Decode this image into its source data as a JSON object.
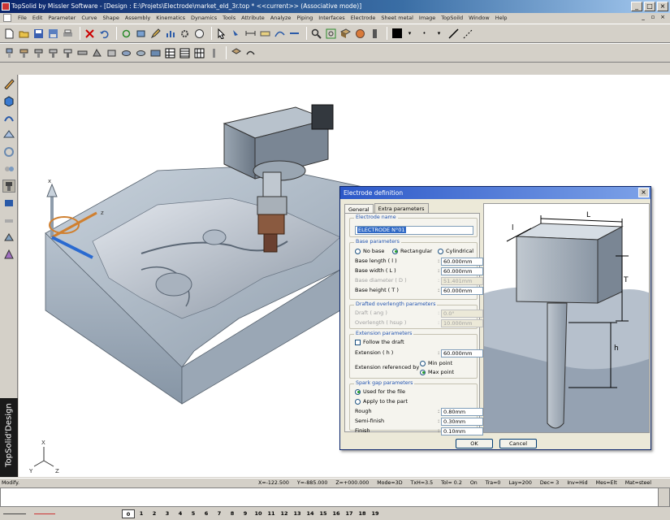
{
  "window": {
    "title": "TopSolid by Missler Software - [Design : E:\\Projets\\Electrode\\market_eld_3r.top *  <<current>> (Associative mode)]"
  },
  "menu": [
    "File",
    "Edit",
    "Parameter",
    "Curve",
    "Shape",
    "Assembly",
    "Kinematics",
    "Dynamics",
    "Tools",
    "Attribute",
    "Analyze",
    "Piping",
    "Interfaces",
    "Electrode",
    "Sheet metal",
    "Image",
    "TopSoild",
    "Window",
    "Help"
  ],
  "brand": {
    "text": "TopSolid'Design"
  },
  "dialog": {
    "title": "Electrode definition",
    "tabs": [
      "General",
      "Extra parameters"
    ],
    "electrode_name": {
      "title": "Electrode name",
      "value": "ELECTRODE N°01"
    },
    "base": {
      "title": "Base parameters",
      "options": [
        "No base",
        "Rectangular",
        "Cylindrical"
      ],
      "selected": "Rectangular",
      "length_label": "Base length ( l )",
      "length": "60.000mm",
      "width_label": "Base width ( L )",
      "width": "60.000mm",
      "diameter_label": "Base diameter ( D )",
      "diameter": "51.401mm",
      "height_label": "Base height ( T )",
      "height": "60.000mm"
    },
    "draft": {
      "title": "Drafted overlength parameters",
      "draft_label": "Draft ( ang )",
      "draft": "0.0°",
      "overlength_label": "Overlength ( hsup )",
      "overlength": "10.000mm"
    },
    "extension": {
      "title": "Extension parameters",
      "follow_label": "Follow the draft",
      "ext_label": "Extension ( h )",
      "ext": "60.000mm",
      "ref_label": "Extension referenced by",
      "ref_options": [
        "Min point",
        "Max point"
      ],
      "ref_selected": "Max point"
    },
    "spark": {
      "title": "Spark gap parameters",
      "options": [
        "Used for the file",
        "Apply to the part"
      ],
      "selected": "Used for the file",
      "rough_label": "Rough",
      "rough": "0.80mm",
      "semi_label": "Semi-finish",
      "semi": "0.30mm",
      "finish_label": "Finish",
      "finish": "0.10mm"
    },
    "ok": "OK",
    "cancel": "Cancel",
    "preview_labels": {
      "L": "L",
      "l": "l",
      "T": "T",
      "h": "h"
    }
  },
  "axes": {
    "x": "X",
    "y": "Y",
    "z": "Z",
    "gx": "x",
    "gz": "z"
  },
  "status": {
    "left": "Modify.",
    "fields": [
      "X=-122.500",
      "Y=-885.000",
      "Z=+000.000",
      "Mode=3D",
      "TxH=3.5",
      "Tol=  0.2",
      "On",
      "Tra=0",
      "Lay=200",
      "Dec= 3",
      "Inv=Hid",
      "Mes=Elt",
      "Mat=steel"
    ]
  },
  "layers": [
    "0",
    "1",
    "2",
    "3",
    "4",
    "5",
    "6",
    "7",
    "8",
    "9",
    "10",
    "11",
    "12",
    "13",
    "14",
    "15",
    "16",
    "17",
    "18",
    "19"
  ]
}
